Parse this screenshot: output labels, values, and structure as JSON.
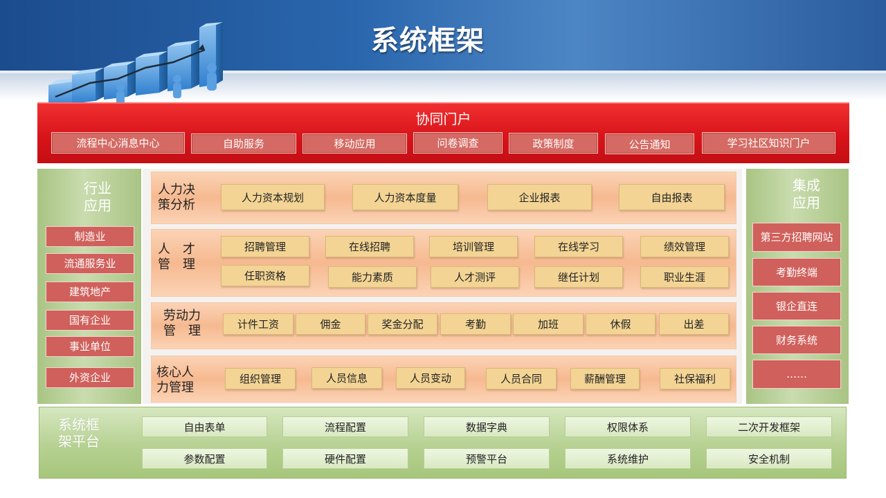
{
  "header": {
    "title": "系统框架"
  },
  "portal": {
    "title": "协同门户",
    "items": [
      "流程中心消息中心",
      "自助服务",
      "移动应用",
      "问卷调查",
      "政策制度",
      "公告通知",
      "学习社区知识门户"
    ]
  },
  "left_panel": {
    "title_line1": "行业",
    "title_line2": "应用",
    "items": [
      "制造业",
      "流通服务业",
      "建筑地产",
      "国有企业",
      "事业单位",
      "外资企业"
    ]
  },
  "right_panel": {
    "title_line1": "集成",
    "title_line2": "应用",
    "items": [
      "第三方招聘网站",
      "考勤终端",
      "银企直连",
      "财务系统",
      "……"
    ]
  },
  "rows": [
    {
      "label_line1": "人力决",
      "label_line2": "策分析",
      "items": [
        "人力资本规划",
        "人力资本度量",
        "企业报表",
        "自由报表"
      ]
    },
    {
      "label_line1": "人　才",
      "label_line2": "管　理",
      "items": [
        "招聘管理",
        "在线招聘",
        "培训管理",
        "在线学习",
        "绩效管理",
        "任职资格",
        "能力素质",
        "人才测评",
        "继任计划",
        "职业生涯"
      ]
    },
    {
      "label_line1": "劳动力",
      "label_line2": "管　理",
      "items": [
        "计件工资",
        "佣金",
        "奖金分配",
        "考勤",
        "加班",
        "休假",
        "出差"
      ]
    },
    {
      "label_line1": "核心人",
      "label_line2": "力管理",
      "items": [
        "组织管理",
        "人员信息",
        "人员变动",
        "人员合同",
        "薪酬管理",
        "社保福利"
      ]
    }
  ],
  "platform": {
    "title_line1": "系统框",
    "title_line2": "架平台",
    "items": [
      "自由表单",
      "流程配置",
      "数据字典",
      "权限体系",
      "二次开发框架",
      "参数配置",
      "硬件配置",
      "预警平台",
      "系统维护",
      "安全机制"
    ]
  },
  "colors": {
    "header_blue": "#1b4c8d",
    "portal_red": "#d8141a",
    "side_green": "#a9c484",
    "row_orange": "#f6b990",
    "button_yellow": "#f3d494",
    "button_red": "#d0605b"
  }
}
